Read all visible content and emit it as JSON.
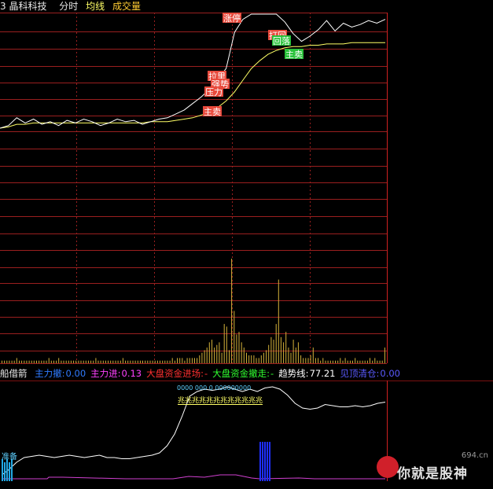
{
  "header": {
    "stock_name": "3 晶科科技",
    "tab_time": "分时",
    "tab_avg": "均线",
    "tab_volume": "成交量"
  },
  "indicator_bar": {
    "name": "船借箭",
    "items": [
      {
        "label": "主力撤:",
        "value": "0.00",
        "color": "#2f7bff"
      },
      {
        "label": "主力进:",
        "value": "0.13",
        "color": "#ff40ff"
      },
      {
        "label": "大盘资金进场:",
        "value": "-",
        "color": "#ff3030"
      },
      {
        "label": "大盘资金撤走:",
        "value": "-",
        "color": "#30ff30"
      },
      {
        "label": "趋势线:",
        "value": "77.21",
        "color": "#ffffff"
      },
      {
        "label": "见顶清仓:",
        "value": "0.00",
        "color": "#5a5aff"
      }
    ]
  },
  "signals": [
    {
      "id": "zhangting",
      "text": "涨停",
      "bg": "#e84a3c",
      "fg": "#ffffff"
    },
    {
      "id": "dahui",
      "text": "打回",
      "bg": "#e84a3c",
      "fg": "#ffffff"
    },
    {
      "id": "huiluo",
      "text": "回落",
      "bg": "#28c23a",
      "fg": "#ffffff"
    },
    {
      "id": "zhumai1",
      "text": "主卖",
      "bg": "#28c23a",
      "fg": "#ffffff"
    },
    {
      "id": "zhumai2",
      "text": "主卖",
      "bg": "#e84a3c",
      "fg": "#ffffff"
    },
    {
      "id": "lali",
      "text": "拉里",
      "bg": "#e84a3c",
      "fg": "#ffffff"
    },
    {
      "id": "shi",
      "text": "强势",
      "bg": "#e84a3c",
      "fg": "#ffffff"
    },
    {
      "id": "yali",
      "text": "压力",
      "bg": "#e84a3c",
      "fg": "#ffffff"
    }
  ],
  "lower_labels": {
    "top_marks": "0000    000  0  000000000",
    "repeat_marks": "兆兆兆兆兆兆兆兆兆兆兆兆",
    "left_label": "准备"
  },
  "watermark": {
    "url": "694.cn",
    "text": "你就是股神"
  },
  "colors": {
    "grid_red": "#9a1f1f",
    "price_line": "#ffffff",
    "avg_line": "#ffff66",
    "volume_bar": "#d4b13a",
    "trend_line": "#ffffff",
    "blue_bars": "#1f2fff",
    "cyan_bars": "#22a9e6",
    "magenta_line": "#d040d0"
  },
  "chart_data": {
    "type": "line",
    "series": [
      {
        "values": [
          1.2,
          1.4,
          2.0,
          1.6,
          1.9,
          1.5,
          1.7,
          1.4,
          1.8,
          1.6,
          1.9,
          1.7,
          1.4,
          1.6,
          1.9,
          1.7,
          1.8,
          1.5,
          1.7,
          1.9,
          2.0,
          2.3,
          2.6,
          3.1,
          3.6,
          4.2,
          5.0,
          5.8,
          8.6,
          9.6,
          10.0,
          10.0,
          10.0,
          10.0,
          9.4,
          8.5,
          7.9,
          8.3,
          8.8,
          9.5,
          8.7,
          9.3,
          9.0,
          9.2,
          9.5,
          9.3,
          9.6
        ]
      },
      {
        "values": [
          1.2,
          1.3,
          1.5,
          1.5,
          1.6,
          1.6,
          1.6,
          1.6,
          1.6,
          1.6,
          1.6,
          1.6,
          1.6,
          1.6,
          1.6,
          1.6,
          1.6,
          1.6,
          1.7,
          1.7,
          1.7,
          1.8,
          1.9,
          2.0,
          2.2,
          2.4,
          2.8,
          3.3,
          4.0,
          4.9,
          5.8,
          6.4,
          6.9,
          7.2,
          7.4,
          7.5,
          7.5,
          7.6,
          7.6,
          7.7,
          7.7,
          7.7,
          7.8,
          7.8,
          7.8,
          7.8,
          7.8
        ]
      },
      {
        "values": [
          1,
          1,
          1,
          1,
          1,
          1,
          2,
          1,
          1,
          1,
          1,
          1,
          1,
          1,
          1,
          1,
          1,
          1,
          1,
          2,
          1,
          1,
          1,
          2,
          1,
          1,
          1,
          1,
          1,
          1,
          1,
          1,
          1,
          1,
          1,
          1,
          1,
          1,
          2,
          1,
          1,
          1,
          1,
          1,
          1,
          1,
          1,
          1,
          1,
          2,
          1,
          1,
          1,
          1,
          1,
          1,
          1,
          1,
          1,
          1,
          1,
          1,
          1,
          1,
          1,
          1,
          1,
          1,
          1,
          2,
          1,
          2,
          2,
          2,
          1,
          2,
          2,
          2,
          2,
          2,
          3,
          4,
          5,
          6,
          8,
          9,
          6,
          7,
          8,
          4,
          15,
          14,
          5,
          40,
          20,
          11,
          12,
          8,
          6,
          4,
          3,
          3,
          3,
          2,
          2,
          3,
          4,
          5,
          7,
          10,
          9,
          15,
          32,
          10,
          8,
          12,
          6,
          4,
          9,
          6,
          8,
          3,
          2,
          2,
          2,
          3,
          6,
          2,
          2,
          1,
          2,
          1,
          1,
          1,
          1,
          1,
          1,
          2,
          1,
          2,
          1,
          1,
          1,
          2,
          1,
          1,
          1,
          1,
          1,
          2,
          1,
          2,
          1,
          1,
          1,
          6
        ]
      },
      {
        "values": [
          5,
          10,
          16,
          20,
          21,
          22,
          21,
          20,
          21,
          22,
          21,
          20,
          21,
          22,
          20,
          20,
          19,
          19,
          20,
          21,
          22,
          24,
          30,
          40,
          55,
          72,
          76,
          78,
          77,
          78,
          80,
          78,
          76,
          78,
          76,
          79,
          80,
          78,
          73,
          66,
          62,
          61,
          62,
          65,
          64,
          63,
          63,
          64,
          63,
          64,
          66,
          67
        ]
      }
    ]
  }
}
